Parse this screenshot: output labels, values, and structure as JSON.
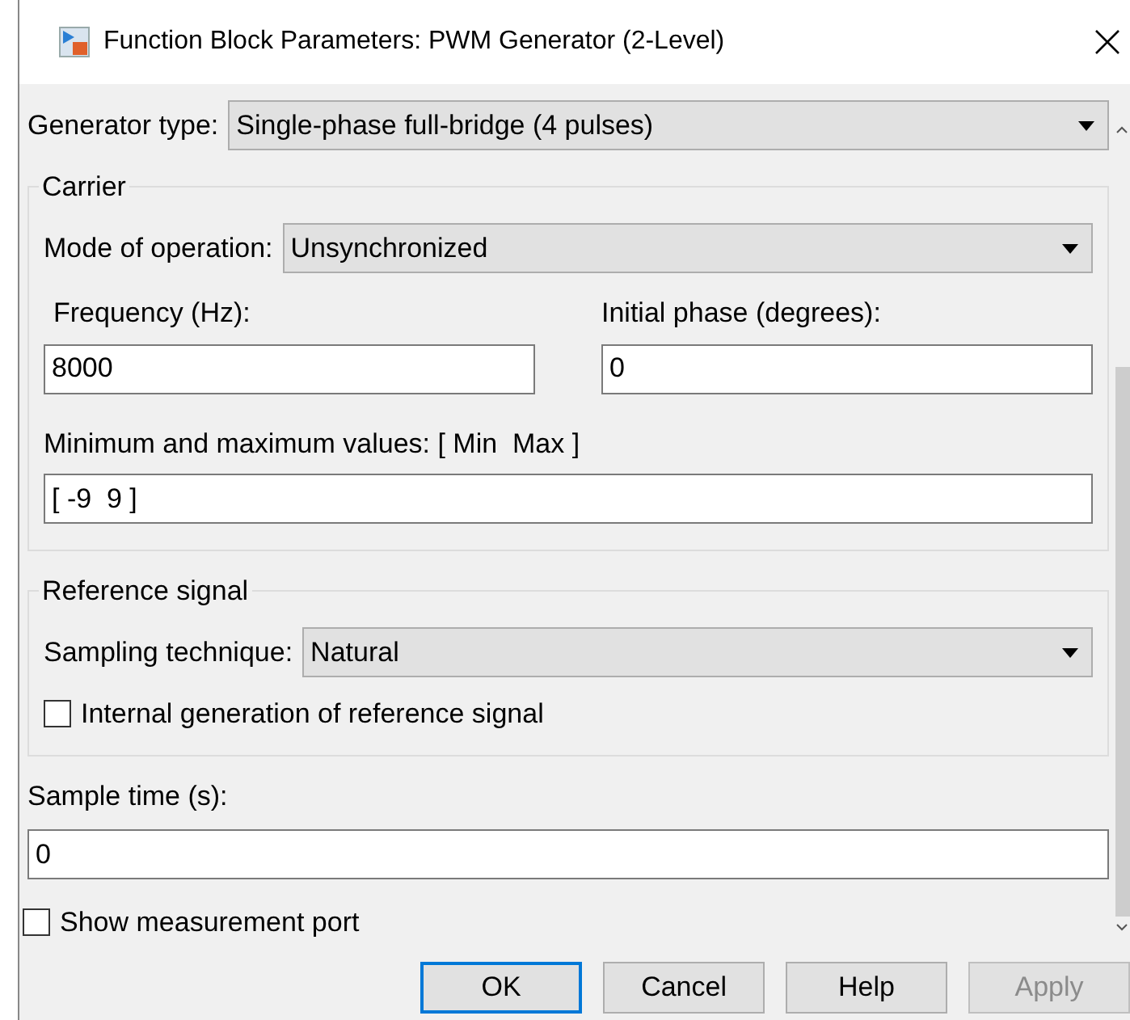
{
  "window": {
    "title": "Function Block Parameters: PWM Generator (2-Level)"
  },
  "generator_type": {
    "label": "Generator type:",
    "value": "Single-phase full-bridge (4 pulses)"
  },
  "carrier": {
    "title": "Carrier",
    "mode": {
      "label": "Mode of operation:",
      "value": "Unsynchronized"
    },
    "frequency": {
      "label": "Frequency (Hz):",
      "value": "8000"
    },
    "initial_phase": {
      "label": "Initial phase (degrees):",
      "value": "0"
    },
    "min_max": {
      "label": "Minimum and maximum values: [ Min  Max ]",
      "value": "[ -9  9 ]"
    }
  },
  "reference_signal": {
    "title": "Reference signal",
    "sampling": {
      "label": "Sampling technique:",
      "value": "Natural"
    },
    "internal_generation": {
      "label": "Internal generation of reference signal",
      "checked": false
    }
  },
  "sample_time": {
    "label": "Sample time (s):",
    "value": "0"
  },
  "show_measurement_port": {
    "label": "Show measurement port",
    "checked": false
  },
  "buttons": [
    {
      "label": "OK",
      "kind": "default",
      "disabled": false
    },
    {
      "label": "Cancel",
      "kind": "normal",
      "disabled": false
    },
    {
      "label": "Help",
      "kind": "normal",
      "disabled": false
    },
    {
      "label": "Apply",
      "kind": "normal",
      "disabled": true
    }
  ]
}
